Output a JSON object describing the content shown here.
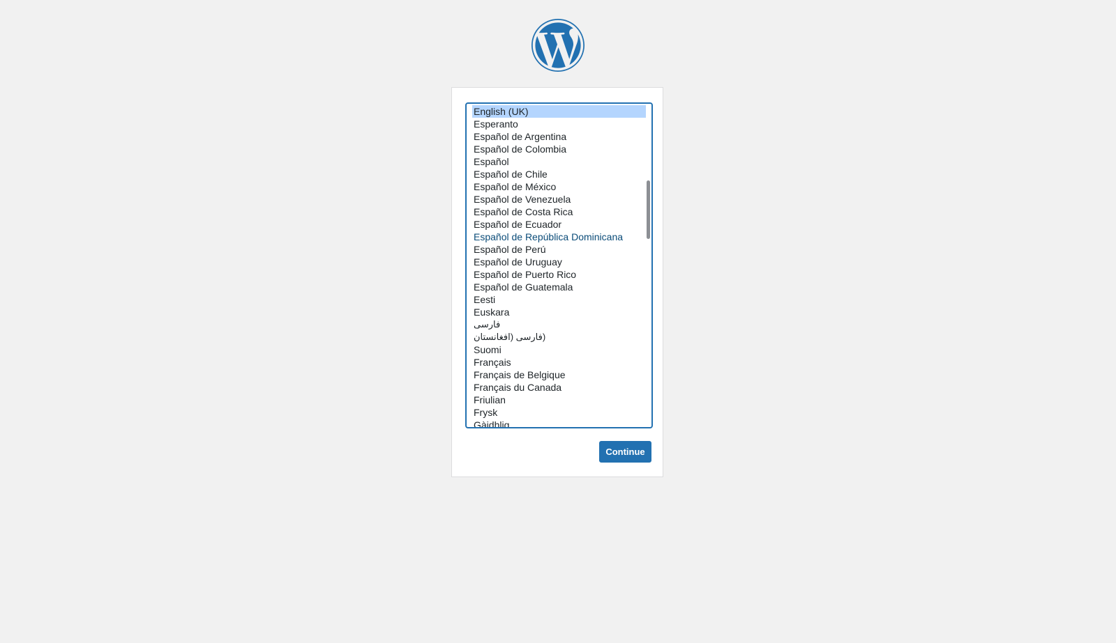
{
  "language_select": {
    "options": [
      "English (UK)",
      "Esperanto",
      "Español de Argentina",
      "Español de Colombia",
      "Español",
      "Español de Chile",
      "Español de México",
      "Español de Venezuela",
      "Español de Costa Rica",
      "Español de Ecuador",
      "Español de República Dominicana",
      "Español de Perú",
      "Español de Uruguay",
      "Español de Puerto Rico",
      "Español de Guatemala",
      "Eesti",
      "Euskara",
      "فارسی",
      "(فارسی (افغانستان",
      "Suomi",
      "Français",
      "Français de Belgique",
      "Français du Canada",
      "Friulian",
      "Frysk",
      "Gàidhlig"
    ],
    "selected_index": 0,
    "hover_index": 10
  },
  "continue_label": "Continue",
  "colors": {
    "accent": "#2271b1",
    "selection": "#b4d5fe",
    "background": "#f1f1f1"
  },
  "icons": {
    "logo": "wordpress-logo-icon"
  }
}
